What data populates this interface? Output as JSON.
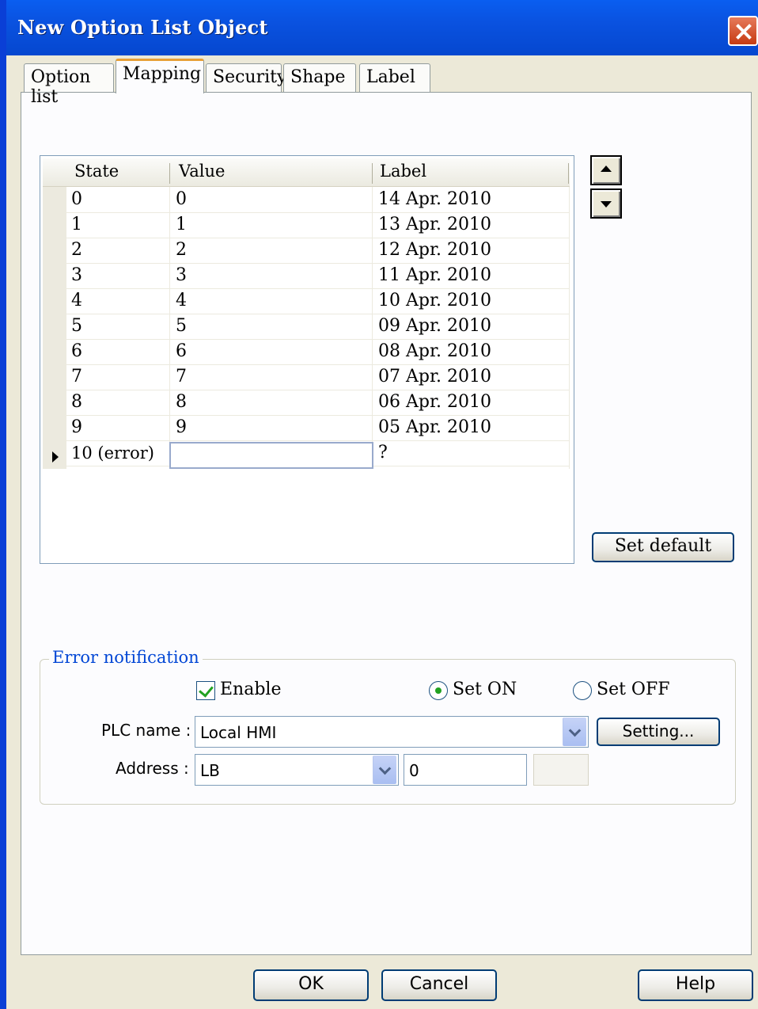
{
  "window": {
    "title": "New  Option List Object"
  },
  "tabs": [
    {
      "label": "Option list"
    },
    {
      "label": "Mapping"
    },
    {
      "label": "Security"
    },
    {
      "label": "Shape"
    },
    {
      "label": "Label"
    }
  ],
  "grid": {
    "columns": [
      "State",
      "Value",
      "Label"
    ],
    "rows": [
      {
        "state": "0",
        "value": "0",
        "label": "14 Apr. 2010"
      },
      {
        "state": "1",
        "value": "1",
        "label": "13 Apr. 2010"
      },
      {
        "state": "2",
        "value": "2",
        "label": "12 Apr. 2010"
      },
      {
        "state": "3",
        "value": "3",
        "label": "11 Apr. 2010"
      },
      {
        "state": "4",
        "value": "4",
        "label": "10 Apr. 2010"
      },
      {
        "state": "5",
        "value": "5",
        "label": "09 Apr. 2010"
      },
      {
        "state": "6",
        "value": "6",
        "label": "08 Apr. 2010"
      },
      {
        "state": "7",
        "value": "7",
        "label": "07 Apr. 2010"
      },
      {
        "state": "8",
        "value": "8",
        "label": "06 Apr. 2010"
      },
      {
        "state": "9",
        "value": "9",
        "label": "05 Apr. 2010"
      },
      {
        "state": "10 (error)",
        "value": "",
        "label": "?"
      }
    ]
  },
  "buttons": {
    "set_default": "Set default",
    "setting": "Setting...",
    "ok": "OK",
    "cancel": "Cancel",
    "help": "Help"
  },
  "error_notification": {
    "legend": "Error notification",
    "enable_label": "Enable",
    "enable_checked": true,
    "set_on_label": "Set ON",
    "set_off_label": "Set OFF",
    "selected_mode": "Set ON",
    "plc_name_label": "PLC name :",
    "plc_name_value": "Local HMI",
    "address_label": "Address :",
    "address_type": "LB",
    "address_value": "0"
  }
}
